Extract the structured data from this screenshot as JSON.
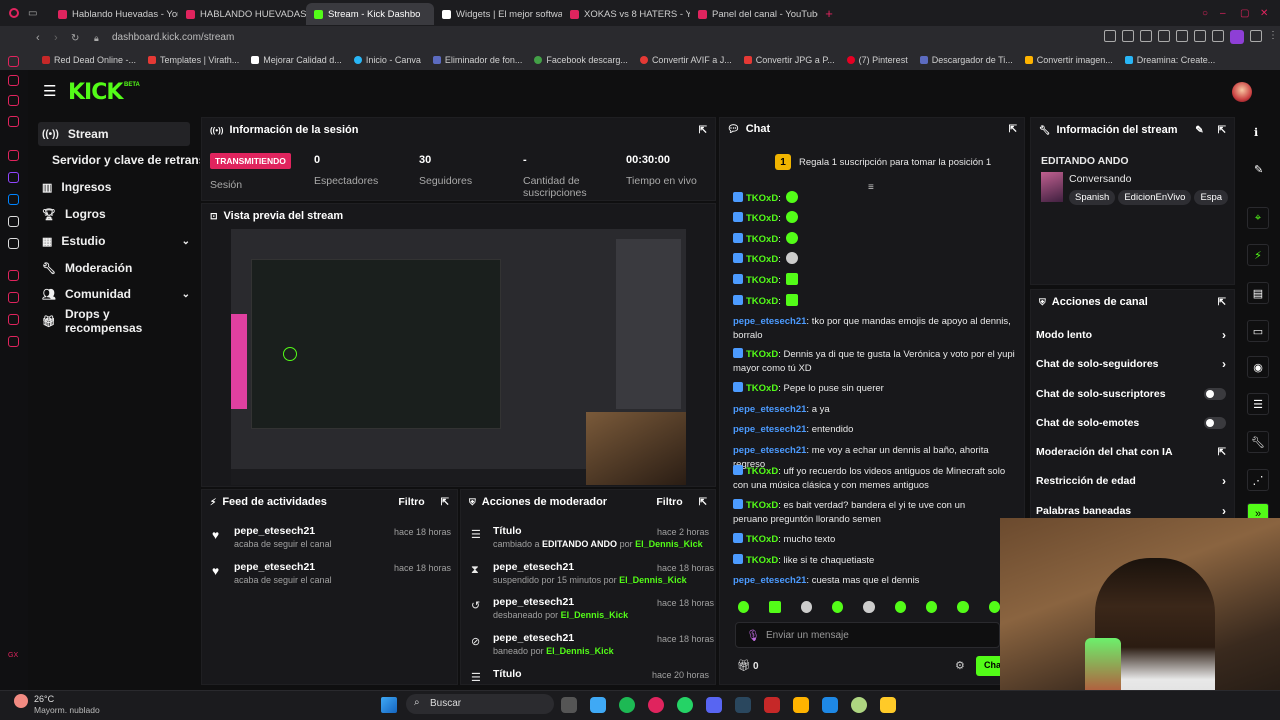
{
  "browser": {
    "tabs": [
      {
        "label": "Hablando Huevadas - You",
        "color": "#e0245e"
      },
      {
        "label": "HABLANDO HUEVADAS -",
        "color": "#e0245e"
      },
      {
        "label": "Stream - Kick Dashbo",
        "color": "#53fc18"
      },
      {
        "label": "Widgets | El mejor softwa",
        "color": "#ffffff"
      },
      {
        "label": "XOKAS vs 8 HATERS - Yo",
        "color": "#e0245e"
      },
      {
        "label": "Panel del canal - YouTube",
        "color": "#e0245e"
      }
    ],
    "url": "dashboard.kick.com/stream",
    "bookmarks": [
      "Red Dead Online -...",
      "Templates | Virath...",
      "Mejorar Calidad d...",
      "Inicio - Canva",
      "Eliminador de fon...",
      "Facebook descarg...",
      "Convertir AVIF a J...",
      "Convertir JPG a P...",
      "(7) Pinterest",
      "Descargador de Ti...",
      "Convertir imagen...",
      "Dreamina: Create..."
    ]
  },
  "header": {
    "logo": "KICK",
    "logo_sup": "BETA"
  },
  "sidebar": {
    "items": [
      {
        "label": "Stream",
        "icon": "broadcast-icon"
      },
      {
        "label": "Servidor y clave de retransmisión",
        "icon": ""
      },
      {
        "label": "Ingresos",
        "icon": "chart-icon"
      },
      {
        "label": "Logros",
        "icon": "trophy-icon"
      },
      {
        "label": "Estudio",
        "icon": "studio-icon"
      },
      {
        "label": "Moderación",
        "icon": "wrench-icon"
      },
      {
        "label": "Comunidad",
        "icon": "community-icon"
      },
      {
        "label": "Drops y recompensas",
        "icon": "gift-icon"
      }
    ]
  },
  "session": {
    "title": "Información de la sesión",
    "live_badge": "TRANSMITIENDO",
    "live_label": "Sesión",
    "stats": [
      {
        "value": "0",
        "label": "Espectadores"
      },
      {
        "value": "30",
        "label": "Seguidores"
      },
      {
        "value": "-",
        "label": "Cantidad de suscripciones"
      },
      {
        "value": "00:30:00",
        "label": "Tiempo en vivo"
      }
    ]
  },
  "preview": {
    "title": "Vista previa del stream"
  },
  "feed": {
    "title": "Feed de actividades",
    "filter": "Filtro",
    "items": [
      {
        "name": "pepe_etesech21",
        "sub": "acaba de seguir el canal",
        "time": "hace 18 horas"
      },
      {
        "name": "pepe_etesech21",
        "sub": "acaba de seguir el canal",
        "time": "hace 18 horas"
      }
    ]
  },
  "modactions": {
    "title": "Acciones de moderador",
    "filter": "Filtro",
    "items": [
      {
        "name": "Título",
        "pre": "cambiado a",
        "mid": "EDITANDO ANDO",
        "por": "por",
        "mod": "El_Dennis_Kick",
        "time": "hace 2 horas"
      },
      {
        "name": "pepe_etesech21",
        "pre": "suspendido por 15 minutos",
        "mid": "",
        "por": "por",
        "mod": "El_Dennis_Kick",
        "time": "hace 18 horas"
      },
      {
        "name": "pepe_etesech21",
        "pre": "desbaneado",
        "mid": "",
        "por": "por",
        "mod": "El_Dennis_Kick",
        "time": "hace 18 horas"
      },
      {
        "name": "pepe_etesech21",
        "pre": "baneado",
        "mid": "",
        "por": "por",
        "mod": "El_Dennis_Kick",
        "time": "hace 18 horas"
      },
      {
        "name": "Título",
        "pre": "",
        "mid": "",
        "por": "",
        "mod": "",
        "time": "hace 20 horas"
      }
    ]
  },
  "chat": {
    "title": "Chat",
    "promo": "Regala 1 suscripción para tomar la posición 1",
    "promo_rank": "1",
    "emote_user": "TKOxD",
    "messages": [
      {
        "user": "pepe_etesech21",
        "text": ": tko por que mandas emojis de apoyo al dennis, borralo",
        "kind": "pe"
      },
      {
        "user": "TKOxD",
        "text": ": Dennis ya di que te gusta la Verónica y voto por el yupi mayor como tú XD",
        "kind": "tk"
      },
      {
        "user": "TKOxD",
        "text": ": Pepe lo puse sin querer",
        "kind": "tk"
      },
      {
        "user": "pepe_etesech21",
        "text": ": a ya",
        "kind": "pe"
      },
      {
        "user": "pepe_etesech21",
        "text": ": entendido",
        "kind": "pe"
      },
      {
        "user": "pepe_etesech21",
        "text": ": me voy a echar un dennis al baño, ahorita regreso",
        "kind": "pe"
      },
      {
        "user": "TKOxD",
        "text": ": uff yo recuerdo los videos antiguos de Minecraft solo con una música clásica y con memes antiguos",
        "kind": "tk"
      },
      {
        "user": "TKOxD",
        "text": ": es bait verdad? bandera el yi te uve con un peruano preguntón llorando semen",
        "kind": "tk"
      },
      {
        "user": "TKOxD",
        "text": ": mucho texto",
        "kind": "tk"
      },
      {
        "user": "TKOxD",
        "text": ": like si te chaquetiaste",
        "kind": "tk"
      },
      {
        "user": "pepe_etesech21",
        "text": ": cuesta mas que el dennis",
        "kind": "pe"
      }
    ],
    "input_placeholder": "Enviar un mensaje",
    "points": "0",
    "send_label": "Chat"
  },
  "streaminfo": {
    "title": "Información del stream",
    "stream_title": "EDITANDO ANDO",
    "category": "Conversando",
    "tags": [
      "Spanish",
      "EdicionEnVivo",
      "Espa"
    ]
  },
  "channelactions": {
    "title": "Acciones de canal",
    "items": [
      {
        "label": "Modo lento",
        "control": "chevron"
      },
      {
        "label": "Chat de solo-seguidores",
        "control": "chevron"
      },
      {
        "label": "Chat de solo-suscriptores",
        "control": "toggle"
      },
      {
        "label": "Chat de solo-emotes",
        "control": "toggle"
      },
      {
        "label": "Moderación del chat con IA",
        "control": "external"
      },
      {
        "label": "Restricción de edad",
        "control": "chevron"
      },
      {
        "label": "Palabras baneadas",
        "control": "chevron"
      }
    ]
  },
  "taskbar": {
    "weather_temp": "26°C",
    "weather_desc": "Mayorm. nublado",
    "search": "Buscar"
  }
}
